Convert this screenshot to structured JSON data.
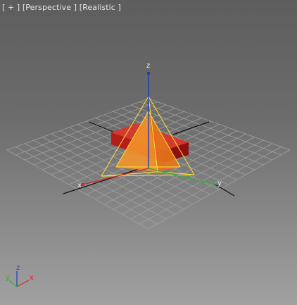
{
  "viewport": {
    "labels": {
      "menu": "[ + ]",
      "view": "[Perspective ]",
      "shading": "[Realistic ]"
    },
    "axes": {
      "x": "x",
      "y": "y",
      "z": "z"
    },
    "gizmo_axes": {
      "x": "x",
      "y": "y",
      "z": "z"
    },
    "colors": {
      "x_axis": "#d22a2a",
      "y_axis": "#2fb33a",
      "z_axis": "#1f3db8",
      "selection_outline": "#ffe033",
      "object_red": "#b81e1e"
    }
  }
}
